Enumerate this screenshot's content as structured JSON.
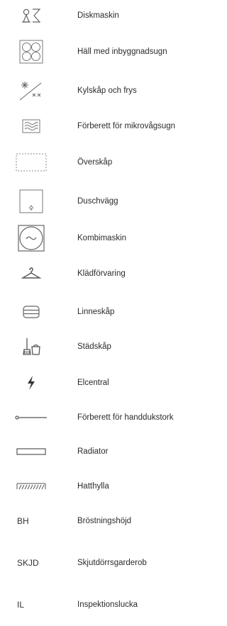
{
  "legend": {
    "items": [
      {
        "icon": "dishwasher-symbol",
        "label": "Diskmaskin"
      },
      {
        "icon": "hob-with-oven-symbol",
        "label": "Häll med inbyggnadsugn"
      },
      {
        "icon": "fridge-freezer-symbol",
        "label": "Kylskåp och frys"
      },
      {
        "icon": "microwave-symbol",
        "label": "Förberett för mikrovågsugn"
      },
      {
        "icon": "wall-cabinet-symbol",
        "label": "Överskåp"
      },
      {
        "icon": "shower-screen-symbol",
        "label": "Duschvägg"
      },
      {
        "icon": "washer-dryer-symbol",
        "label": "Kombimaskin"
      },
      {
        "icon": "clothes-hanger-symbol",
        "label": "Klädförvaring"
      },
      {
        "icon": "linen-cabinet-symbol",
        "label": "Linneskåp"
      },
      {
        "icon": "cleaning-cabinet-symbol",
        "label": "Städskåp"
      },
      {
        "icon": "electrical-panel-symbol",
        "label": "Elcentral"
      },
      {
        "icon": "towel-dryer-symbol",
        "label": "Förberett för handdukstork"
      },
      {
        "icon": "radiator-symbol",
        "label": "Radiator"
      },
      {
        "icon": "hat-shelf-symbol",
        "label": "Hatthylla"
      },
      {
        "abbr": "BH",
        "label": "Bröstningshöjd"
      },
      {
        "abbr": "SKJD",
        "label": "Skjutdörrsgarderob"
      },
      {
        "abbr": "IL",
        "label": "Inspektionslucka"
      }
    ]
  }
}
